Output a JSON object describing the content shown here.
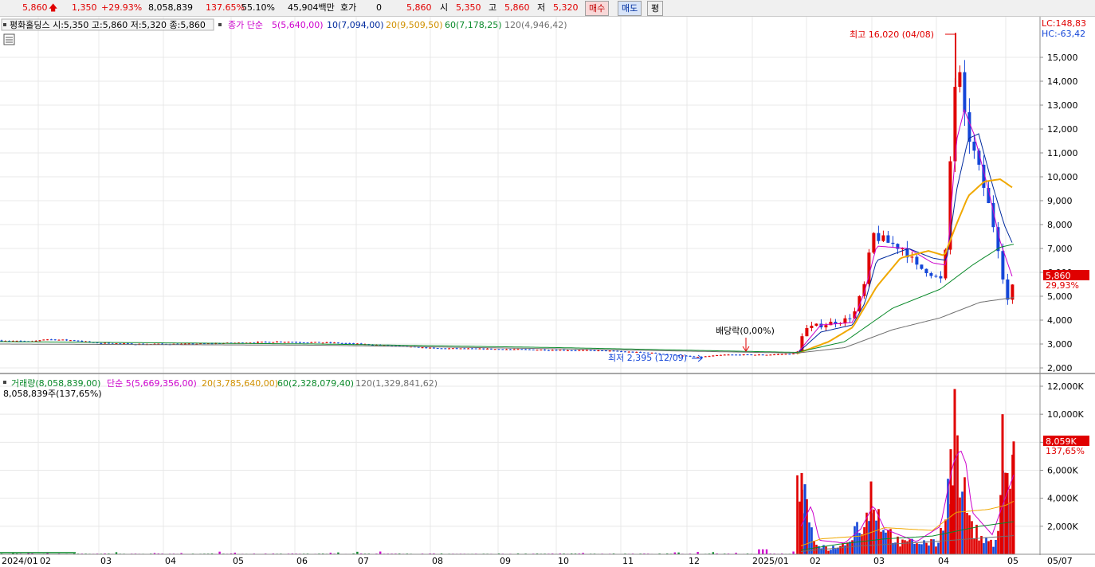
{
  "header": {
    "price": "5,860",
    "change": "1,350",
    "change_pct": "+29.93%",
    "volume": "8,058,839",
    "volume_ratio": "137.65%",
    "turnover": "55.10%",
    "amount": "45,904백만",
    "quote_label": "호가",
    "quote_value": "0",
    "bid": "5,860",
    "open_label": "시",
    "open": "5,350",
    "high_label": "고",
    "high": "5,860",
    "low_label": "저",
    "low": "5,320",
    "buy_label": "매수",
    "sell_label": "매도",
    "avg_label": "평"
  },
  "price_panel": {
    "info": "평화홀딩스 시:5,350 고:5,860 저:5,320 종:5,860",
    "ma_title": "종가 단순",
    "ma_labels": [
      "5(5,640,00)",
      "10(7,094,00)",
      "20(9,509,50)",
      "60(7,178,25)",
      "120(4,946,42)"
    ],
    "lc": "LC:148,83",
    "hc": "HC:-63,42",
    "last_tag": "5,860",
    "last_pct": "29,93%",
    "high_annot": "최고 16,020 (04/08)",
    "low_annot": "최저 2,395 (12/09)",
    "div_annot": "배당락(0,00%)"
  },
  "volume_panel": {
    "ma_title": "거래량(8,058,839,00)",
    "ma_labels": [
      "단순 5(5,669,356,00)",
      "20(3,785,640,00)",
      "60(2,328,079,40)",
      "120(1,329,841,62)"
    ],
    "sub": "8,058,839주(137,65%)",
    "last_tag": "8,059K",
    "last_pct": "137,65%"
  },
  "colors": {
    "up": "#e00000",
    "down": "#1446d8",
    "ma5": "#cc00cc",
    "ma10": "#002a9e",
    "ma20": "#f0a800",
    "ma60": "#0a8a2a",
    "ma120": "#707070"
  },
  "chart_data": {
    "type": "candlestick",
    "price_axis": {
      "min": 1700,
      "max": 16500,
      "ticks": [
        2000,
        3000,
        4000,
        5000,
        6000,
        7000,
        8000,
        9000,
        10000,
        11000,
        12000,
        13000,
        14000,
        15000
      ]
    },
    "volume_axis": {
      "min": 0,
      "max": 12500000,
      "ticks": [
        2000000,
        4000000,
        6000000,
        8000000,
        10000000,
        12000000
      ],
      "tick_labels": [
        "2,000K",
        "4,000K",
        "6,000K",
        "8,000K",
        "10,000K",
        "12,000K"
      ]
    },
    "x_labels": [
      "2024/01",
      "02",
      "03",
      "04",
      "05",
      "06",
      "07",
      "08",
      "09",
      "10",
      "11",
      "12",
      "2025/01",
      "02",
      "03",
      "04",
      "05",
      "05/07"
    ],
    "price_keypoints": [
      [
        0,
        3150
      ],
      [
        40,
        3100
      ],
      [
        56,
        3200
      ],
      [
        95,
        3150
      ],
      [
        118,
        3050
      ],
      [
        170,
        3000
      ],
      [
        230,
        3000
      ],
      [
        300,
        3050
      ],
      [
        350,
        3100
      ],
      [
        420,
        3050
      ],
      [
        480,
        2950
      ],
      [
        545,
        2820
      ],
      [
        600,
        2800
      ],
      [
        700,
        2750
      ],
      [
        760,
        2720
      ],
      [
        820,
        2620
      ],
      [
        875,
        2450
      ],
      [
        910,
        2550
      ],
      [
        960,
        2550
      ],
      [
        1000,
        2600
      ],
      [
        1008,
        3600
      ],
      [
        1030,
        3800
      ],
      [
        1060,
        4000
      ],
      [
        1072,
        4300
      ],
      [
        1085,
        5500
      ],
      [
        1095,
        7600
      ],
      [
        1110,
        7300
      ],
      [
        1135,
        7000
      ],
      [
        1150,
        6200
      ],
      [
        1165,
        6100
      ],
      [
        1180,
        5600
      ],
      [
        1188,
        7100
      ],
      [
        1196,
        13500
      ],
      [
        1203,
        14500
      ],
      [
        1210,
        12400
      ],
      [
        1222,
        11000
      ],
      [
        1235,
        9500
      ],
      [
        1245,
        8200
      ],
      [
        1255,
        6700
      ],
      [
        1262,
        5000
      ],
      [
        1268,
        4600
      ],
      [
        1272,
        5860
      ]
    ],
    "ma_keypoints": {
      "ma5": [
        [
          1000,
          2600
        ],
        [
          1030,
          3800
        ],
        [
          1070,
          3900
        ],
        [
          1085,
          5200
        ],
        [
          1100,
          7100
        ],
        [
          1140,
          7000
        ],
        [
          1170,
          6400
        ],
        [
          1188,
          6300
        ],
        [
          1200,
          11500
        ],
        [
          1210,
          12800
        ],
        [
          1222,
          11800
        ],
        [
          1240,
          9500
        ],
        [
          1255,
          7300
        ],
        [
          1272,
          5640
        ]
      ],
      "ma10": [
        [
          1000,
          2600
        ],
        [
          1030,
          3500
        ],
        [
          1070,
          3800
        ],
        [
          1085,
          4700
        ],
        [
          1100,
          6500
        ],
        [
          1140,
          7000
        ],
        [
          1170,
          6600
        ],
        [
          1188,
          6500
        ],
        [
          1200,
          9400
        ],
        [
          1215,
          11600
        ],
        [
          1228,
          11800
        ],
        [
          1245,
          9700
        ],
        [
          1260,
          8000
        ],
        [
          1272,
          7094
        ]
      ],
      "ma20": [
        [
          1000,
          2600
        ],
        [
          1040,
          3100
        ],
        [
          1070,
          3700
        ],
        [
          1100,
          5400
        ],
        [
          1130,
          6600
        ],
        [
          1165,
          6900
        ],
        [
          1185,
          6700
        ],
        [
          1200,
          8000
        ],
        [
          1215,
          9200
        ],
        [
          1235,
          9800
        ],
        [
          1255,
          9900
        ],
        [
          1272,
          9510
        ]
      ],
      "ma60": [
        [
          0,
          3100
        ],
        [
          400,
          3000
        ],
        [
          700,
          2850
        ],
        [
          1000,
          2650
        ],
        [
          1060,
          3100
        ],
        [
          1120,
          4500
        ],
        [
          1180,
          5300
        ],
        [
          1220,
          6300
        ],
        [
          1255,
          7050
        ],
        [
          1272,
          7178
        ]
      ],
      "ma120": [
        [
          0,
          3000
        ],
        [
          400,
          2950
        ],
        [
          700,
          2800
        ],
        [
          1000,
          2620
        ],
        [
          1060,
          2850
        ],
        [
          1120,
          3600
        ],
        [
          1180,
          4100
        ],
        [
          1230,
          4750
        ],
        [
          1272,
          4946
        ]
      ]
    },
    "volume_keypoints": [
      [
        1006,
        5800000
      ],
      [
        1010,
        5000000
      ],
      [
        1015,
        2500000
      ],
      [
        1022,
        1200000
      ],
      [
        1040,
        500000
      ],
      [
        1060,
        1000000
      ],
      [
        1075,
        2800000
      ],
      [
        1085,
        2500000
      ],
      [
        1093,
        5200000
      ],
      [
        1110,
        2500000
      ],
      [
        1130,
        1000000
      ],
      [
        1150,
        1200000
      ],
      [
        1175,
        1000000
      ],
      [
        1186,
        3500000
      ],
      [
        1192,
        7500000
      ],
      [
        1198,
        11800000
      ],
      [
        1204,
        7000000
      ],
      [
        1212,
        5200000
      ],
      [
        1220,
        2500000
      ],
      [
        1235,
        1200000
      ],
      [
        1250,
        1000000
      ],
      [
        1258,
        10000000
      ],
      [
        1264,
        5800000
      ],
      [
        1272,
        8058839
      ]
    ],
    "volume_ma_keypoints": {
      "ma5": [
        [
          1005,
          2000000
        ],
        [
          1018,
          3500000
        ],
        [
          1028,
          1000000
        ],
        [
          1060,
          800000
        ],
        [
          1080,
          1800000
        ],
        [
          1096,
          3500000
        ],
        [
          1110,
          1800000
        ],
        [
          1150,
          900000
        ],
        [
          1180,
          2000000
        ],
        [
          1196,
          6500000
        ],
        [
          1205,
          7500000
        ],
        [
          1212,
          6500000
        ],
        [
          1220,
          3000000
        ],
        [
          1245,
          1400000
        ],
        [
          1260,
          3800000
        ],
        [
          1272,
          5669356
        ]
      ],
      "ma20": [
        [
          1005,
          600000
        ],
        [
          1030,
          1100000
        ],
        [
          1080,
          1300000
        ],
        [
          1110,
          1900000
        ],
        [
          1170,
          1700000
        ],
        [
          1200,
          3000000
        ],
        [
          1240,
          3200000
        ],
        [
          1262,
          3500000
        ],
        [
          1272,
          3785640
        ]
      ],
      "ma60": [
        [
          1005,
          300000
        ],
        [
          1050,
          700000
        ],
        [
          1110,
          1100000
        ],
        [
          1170,
          1300000
        ],
        [
          1230,
          2000000
        ],
        [
          1272,
          2328079
        ]
      ],
      "ma120": [
        [
          1005,
          200000
        ],
        [
          1080,
          600000
        ],
        [
          1170,
          900000
        ],
        [
          1272,
          1329841
        ]
      ]
    },
    "annotations": [
      {
        "text": "최고 16,020 (04/08)",
        "x_date": "2025/04/08",
        "value": 16020
      },
      {
        "text": "최저 2,395 (12/09)",
        "x_date": "2024/12/09",
        "value": 2395
      },
      {
        "text": "배당락(0,00%)",
        "value": 2620
      }
    ]
  }
}
